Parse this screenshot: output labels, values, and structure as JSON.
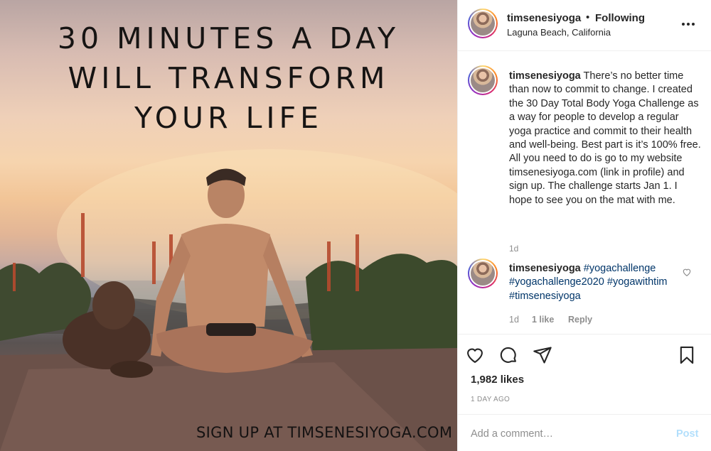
{
  "post_image": {
    "headline_lines": [
      "30 MINUTES A DAY",
      "WILL TRANSFORM",
      "YOUR LIFE"
    ],
    "footer_text": "SIGN UP AT TIMSENESIYOGA.COM"
  },
  "header": {
    "username": "timsenesiyoga",
    "separator": "•",
    "follow_status": "Following",
    "location": "Laguna Beach, California",
    "more_icon": "more-horizontal-icon"
  },
  "caption": {
    "username": "timsenesiyoga",
    "text": "There’s no better time than now to commit to change. I created the 30 Day Total Body Yoga Challenge as a way for people to develop a regular yoga practice and commit to their health and well-being. Best part is it’s 100% free. All you need to do is go to my website timsenesiyoga.com (link in profile) and sign up. The challenge starts Jan 1. I hope to see you on the mat with me.",
    "time": "1d"
  },
  "comment": {
    "username": "timsenesiyoga",
    "hashtags": [
      "#yogachallenge",
      "#yogachallenge2020",
      "#yogawithtim",
      "#timsenesiyoga"
    ],
    "time": "1d",
    "likes": "1 like",
    "reply": "Reply"
  },
  "actions": {
    "likes_count": "1,982 likes",
    "post_age": "1 DAY AGO"
  },
  "add_comment": {
    "placeholder": "Add a comment…",
    "post_label": "Post"
  },
  "colors": {
    "text": "#262626",
    "muted": "#8e8e8e",
    "hashtag": "#003569",
    "post_disabled": "#b2dffc"
  }
}
